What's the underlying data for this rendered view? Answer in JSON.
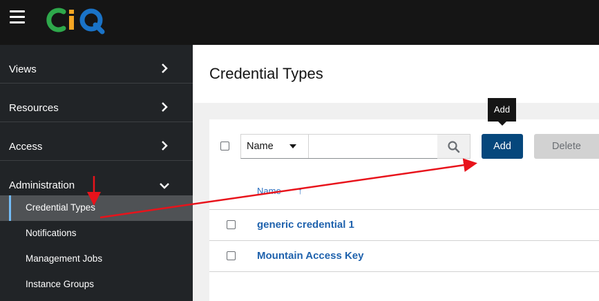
{
  "header": {
    "logo_text": "CIQ",
    "logo_colors": {
      "c": "#2ea84b",
      "i": "#f5a623",
      "q": "#1a73c7"
    }
  },
  "sidebar": {
    "groups": [
      {
        "label": "Views"
      },
      {
        "label": "Resources"
      },
      {
        "label": "Access"
      },
      {
        "label": "Administration"
      }
    ],
    "items": [
      {
        "label": "Credential Types",
        "active": true
      },
      {
        "label": "Notifications"
      },
      {
        "label": "Management Jobs"
      },
      {
        "label": "Instance Groups"
      }
    ]
  },
  "main": {
    "title": "Credential Types",
    "toolbar": {
      "filter_selected": "Name",
      "search_value": "",
      "add_label": "Add",
      "delete_label": "Delete",
      "tooltip": "Add"
    },
    "table": {
      "column_header": "Name",
      "sort_indicator": "↑",
      "rows": [
        {
          "name": "generic credential 1"
        },
        {
          "name": "Mountain Access Key"
        }
      ]
    }
  },
  "colors": {
    "primary": "#06477c",
    "link": "#1f62ad",
    "annotation": "#e8131b"
  }
}
